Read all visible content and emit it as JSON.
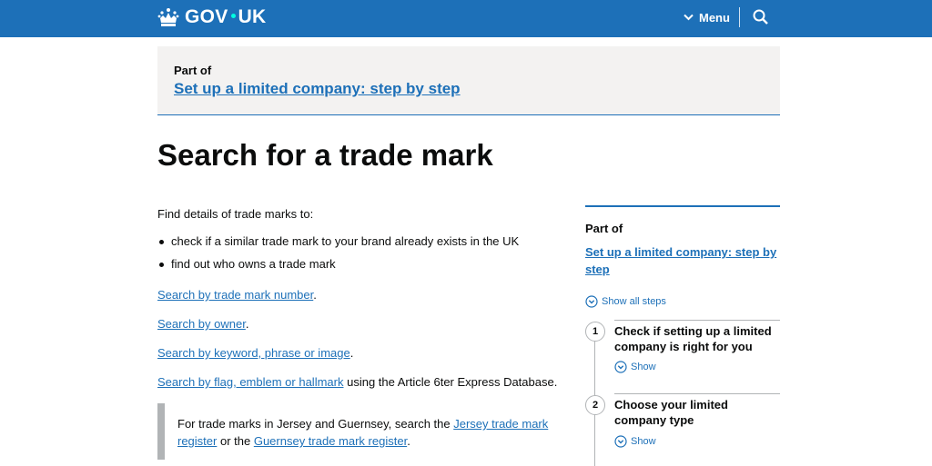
{
  "header": {
    "logo_text_a": "GOV",
    "logo_text_b": "UK",
    "menu_label": "Menu",
    "colors": {
      "brand": "#1d70b8",
      "logo_dot": "#00ffe0"
    }
  },
  "part_of": {
    "label": "Part of",
    "link": "Set up a limited company: step by step"
  },
  "page": {
    "title": "Search for a trade mark",
    "intro": "Find details of trade marks to:",
    "bullets": [
      "check if a similar trade mark to your brand already exists in the UK",
      "find out who owns a trade mark"
    ],
    "links": {
      "by_number": "Search by trade mark number",
      "by_owner": "Search by owner",
      "by_keyword": "Search by keyword, phrase or image",
      "by_flag": "Search by flag, emblem or hallmark",
      "by_flag_suffix": " using the Article 6ter Express Database."
    },
    "period": "."
  },
  "inset": {
    "prefix": "For trade marks in Jersey and Guernsey, search the ",
    "jersey_link": "Jersey trade mark register",
    "middle": " or the ",
    "guernsey_link": "Guernsey trade mark register",
    "suffix": "."
  },
  "sidebar": {
    "part_of": "Part of",
    "link": "Set up a limited company: step by step",
    "show_all": "Show all steps",
    "steps": [
      {
        "number": "1",
        "title": "Check if setting up a limited company is right for you",
        "show": "Show"
      },
      {
        "number": "2",
        "title": "Choose your limited company type",
        "show": "Show"
      }
    ]
  }
}
